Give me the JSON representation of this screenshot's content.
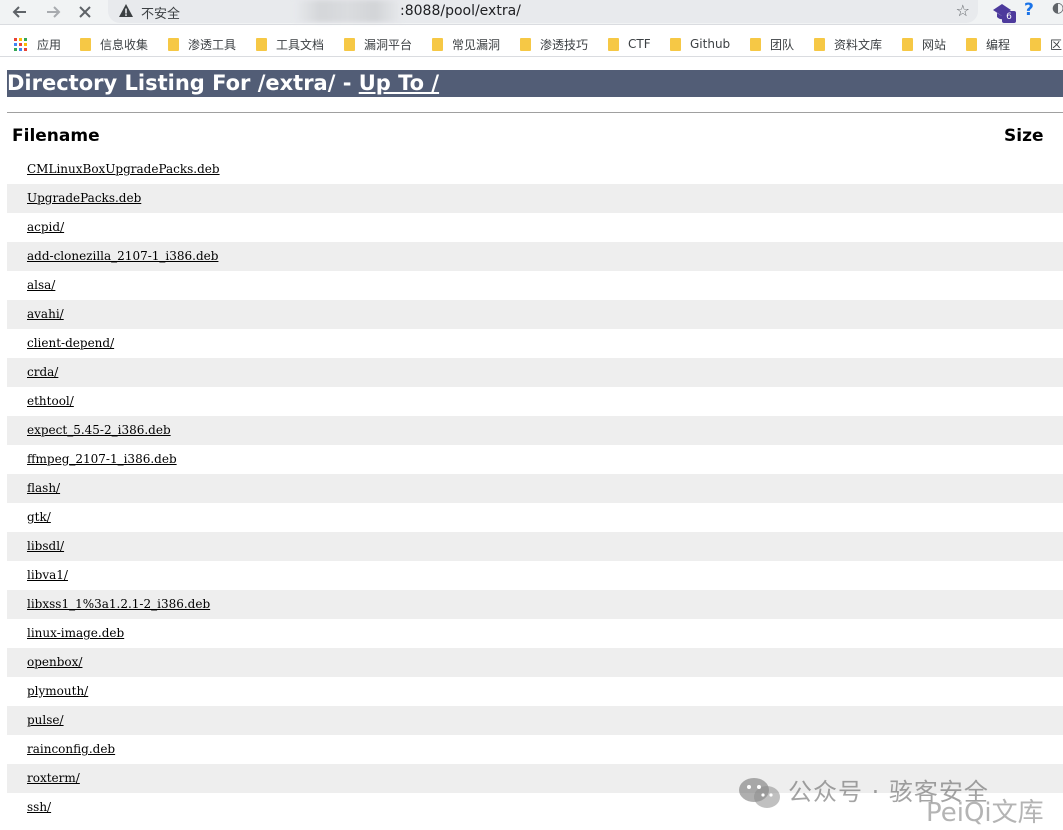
{
  "browser": {
    "security_label": "不安全",
    "url_visible": ":8088/pool/extra/",
    "extension_badge": "6",
    "help_glyph": "?"
  },
  "bookmarks": [
    {
      "label": "应用",
      "icon": "apps-grid-icon"
    },
    {
      "label": "信息收集",
      "icon": "folder-icon"
    },
    {
      "label": "渗透工具",
      "icon": "folder-icon"
    },
    {
      "label": "工具文档",
      "icon": "folder-icon"
    },
    {
      "label": "漏洞平台",
      "icon": "folder-icon"
    },
    {
      "label": "常见漏洞",
      "icon": "folder-icon"
    },
    {
      "label": "渗透技巧",
      "icon": "folder-icon"
    },
    {
      "label": "CTF",
      "icon": "folder-icon"
    },
    {
      "label": "Github",
      "icon": "folder-icon"
    },
    {
      "label": "团队",
      "icon": "folder-icon"
    },
    {
      "label": "资料文库",
      "icon": "folder-icon"
    },
    {
      "label": "网站",
      "icon": "folder-icon"
    },
    {
      "label": "编程",
      "icon": "folder-icon"
    },
    {
      "label": "区",
      "icon": "folder-icon"
    }
  ],
  "page": {
    "heading_prefix": "Directory Listing For /extra/ - ",
    "heading_link": "Up To /",
    "col_filename": "Filename",
    "col_size": "Size",
    "files": [
      "CMLinuxBoxUpgradePacks.deb",
      "UpgradePacks.deb",
      "acpid/",
      "add-clonezilla_2107-1_i386.deb",
      "alsa/",
      "avahi/",
      "client-depend/",
      "crda/",
      "ethtool/",
      "expect_5.45-2_i386.deb",
      "ffmpeg_2107-1_i386.deb",
      "flash/",
      "gtk/",
      "libsdl/",
      "libva1/",
      "libxss1_1%3a1.2.1-2_i386.deb",
      "linux-image.deb",
      "openbox/",
      "plymouth/",
      "pulse/",
      "rainconfig.deb",
      "roxterm/",
      "ssh/"
    ]
  },
  "watermark": {
    "line1": "公众号 · 骇客安全",
    "line2": "PeiQi文库"
  },
  "colors": {
    "heading_bg": "#525d76",
    "row_alt": "#eeeeee",
    "folder": "#f6c845"
  }
}
